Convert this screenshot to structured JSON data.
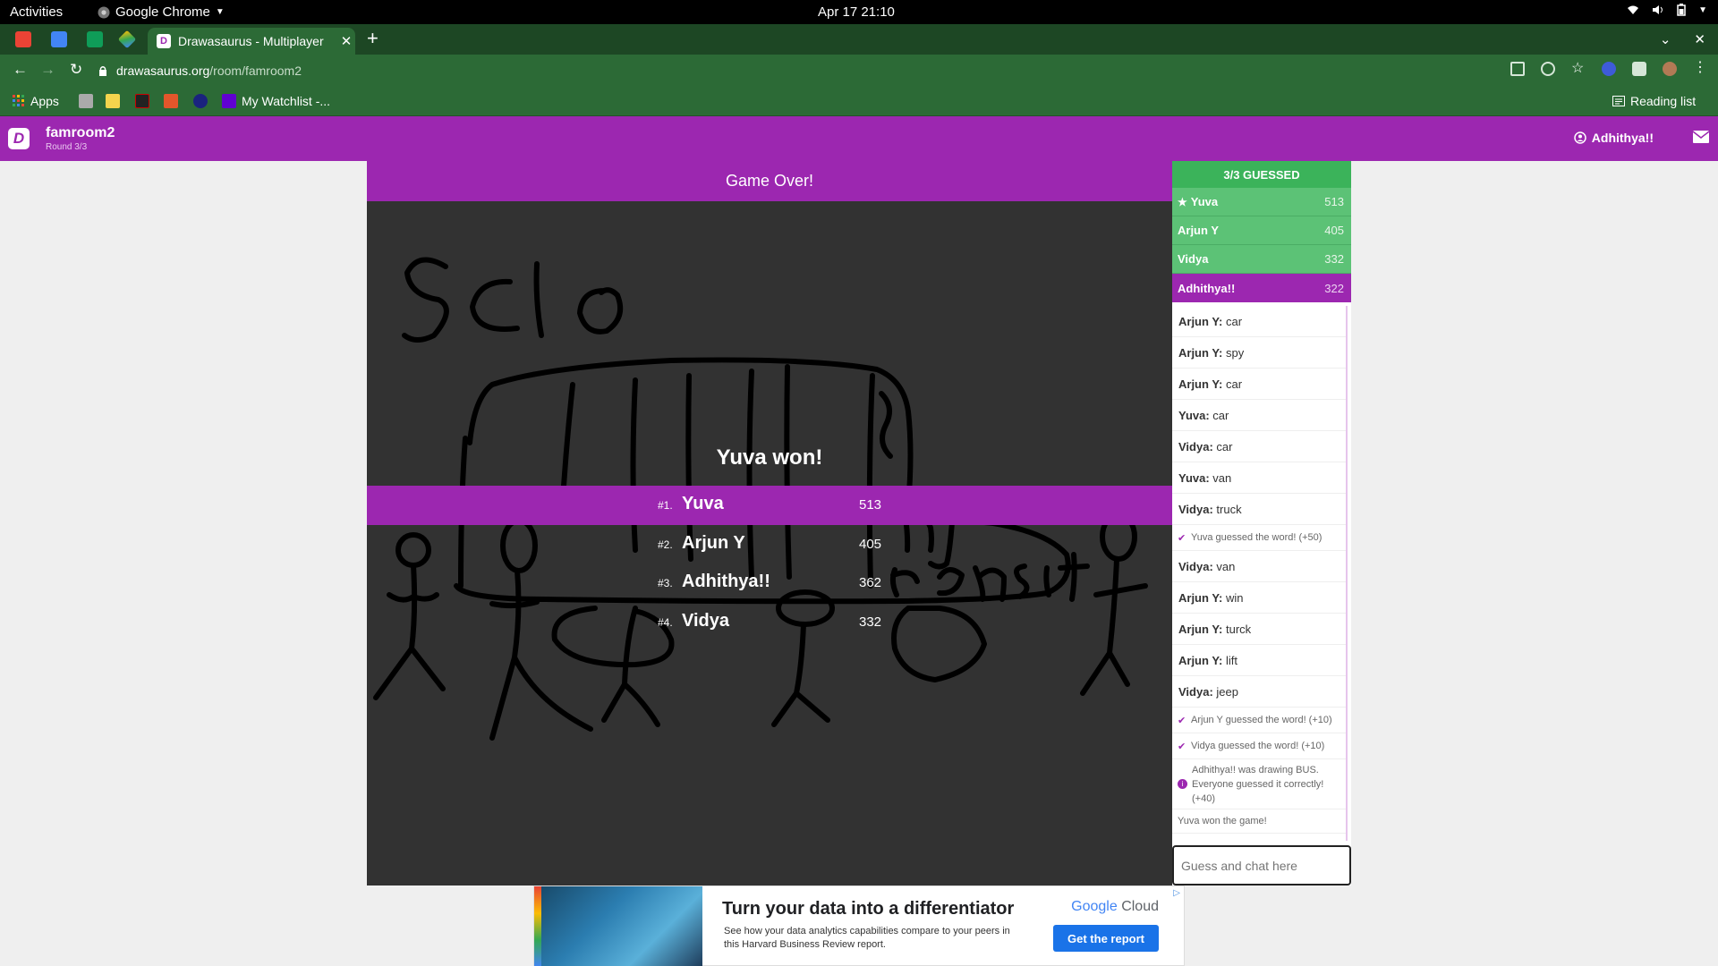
{
  "system_bar": {
    "activities": "Activities",
    "app_name": "Google Chrome",
    "clock": "Apr 17  21:10"
  },
  "browser": {
    "active_tab_title": "Drawasaurus - Multiplayer",
    "url_host": "drawasaurus.org",
    "url_path": "/room/famroom2",
    "bookmarks": {
      "apps": "Apps",
      "watchlist": "My Watchlist -...",
      "reading_list": "Reading list"
    }
  },
  "site": {
    "logo": "D",
    "room_name": "famroom2",
    "round": "Round 3/3",
    "username": "Adhithya!!"
  },
  "game": {
    "banner": "Game Over!",
    "winner_text": "Yuva won!",
    "leaderboard": [
      {
        "rank": "#1.",
        "name": "Yuva",
        "points": "513"
      },
      {
        "rank": "#2.",
        "name": "Arjun Y",
        "points": "405"
      },
      {
        "rank": "#3.",
        "name": "Adhithya!!",
        "points": "362"
      },
      {
        "rank": "#4.",
        "name": "Vidya",
        "points": "332"
      }
    ]
  },
  "sidebar": {
    "guessed_header": "3/3 GUESSED",
    "players": [
      {
        "name": "Yuva",
        "score": "513",
        "star": "★"
      },
      {
        "name": "Arjun Y",
        "score": "405"
      },
      {
        "name": "Vidya",
        "score": "332"
      },
      {
        "name": "Adhithya!!",
        "score": "322"
      }
    ],
    "chat": [
      {
        "type": "msg",
        "user": "Arjun Y:",
        "text": " car"
      },
      {
        "type": "msg",
        "user": "Arjun Y:",
        "text": " spy"
      },
      {
        "type": "msg",
        "user": "Arjun Y:",
        "text": " car"
      },
      {
        "type": "msg",
        "user": "Yuva:",
        "text": " car"
      },
      {
        "type": "msg",
        "user": "Vidya:",
        "text": " car"
      },
      {
        "type": "msg",
        "user": "Yuva:",
        "text": " van"
      },
      {
        "type": "msg",
        "user": "Vidya:",
        "text": " truck"
      },
      {
        "type": "sys",
        "text": "Yuva guessed the word! (+50)"
      },
      {
        "type": "msg",
        "user": "Vidya:",
        "text": " van"
      },
      {
        "type": "msg",
        "user": "Arjun Y:",
        "text": " win"
      },
      {
        "type": "msg",
        "user": "Arjun Y:",
        "text": " turck"
      },
      {
        "type": "msg",
        "user": "Arjun Y:",
        "text": " lift"
      },
      {
        "type": "msg",
        "user": "Vidya:",
        "text": " jeep"
      },
      {
        "type": "sys",
        "text": "Arjun Y guessed the word! (+10)"
      },
      {
        "type": "sys",
        "text": "Vidya guessed the word! (+10)"
      },
      {
        "type": "info",
        "text": "Adhithya!! was drawing BUS. Everyone guessed it correctly! (+40)"
      },
      {
        "type": "plain",
        "text": "Yuva won the game!"
      }
    ],
    "input_placeholder": "Guess and chat here"
  },
  "ad": {
    "headline": "Turn your data into a differentiator",
    "body": "See how your data analytics capabilities compare to your peers in this Harvard Business Review report.",
    "brand_google": "Google",
    "brand_cloud": " Cloud",
    "cta": "Get the report"
  },
  "colors": {
    "site_purple": "#9c27b0",
    "guessed_green": "#3bb35a",
    "canvas": "#323232",
    "chrome_green": "#2c6a36"
  }
}
